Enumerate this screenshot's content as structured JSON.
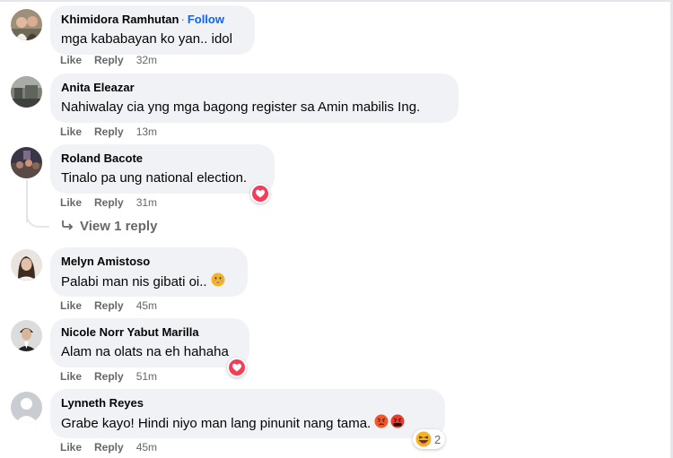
{
  "actions": {
    "like": "Like",
    "reply": "Reply"
  },
  "comments": [
    {
      "author": "Khimidora Ramhutan",
      "follow_separator": "·",
      "follow_label": "Follow",
      "text": "mga kababayan ko yan.. idol",
      "time": "32m",
      "avatar": "avatar-photo-couple"
    },
    {
      "author": "Anita Eleazar",
      "text": "Nahiwalay cia yng mga bagong register sa Amin mabilis Ing.",
      "time": "13m",
      "avatar": "avatar-photo-landscape"
    },
    {
      "author": "Roland Bacote",
      "text": "Tinalo pa ung national election.",
      "time": "31m",
      "avatar": "avatar-photo-crowd",
      "reaction": "heart-reaction-icon",
      "view_replies": "View 1 reply"
    },
    {
      "author": "Melyn Amistoso",
      "text": "Palabi man nis gibati oi..",
      "time": "45m",
      "avatar": "avatar-photo-woman",
      "inline_emoji": "grinning-sweat-emoji-icon"
    },
    {
      "author": "Nicole Norr Yabut Marilla",
      "text": "Alam na olats na eh hahaha",
      "time": "51m",
      "avatar": "avatar-photo-man",
      "reaction": "heart-reaction-icon"
    },
    {
      "author": "Lynneth Reyes",
      "text": "Grabe kayo! Hindi niyo man lang pinunit nang tama.",
      "time": "45m",
      "avatar": "default-avatar-icon",
      "inline_emoji": [
        "angry-emoji-icon",
        "cursing-emoji-icon"
      ],
      "reaction": "haha-reaction-icon",
      "reaction_count": "2"
    }
  ],
  "colors": {
    "bubble": "#f0f2f5",
    "secondary_text": "#65676b",
    "follow_link": "#0866ff",
    "heart": "#f33e58",
    "emoji_yellow": "#f7b125"
  }
}
